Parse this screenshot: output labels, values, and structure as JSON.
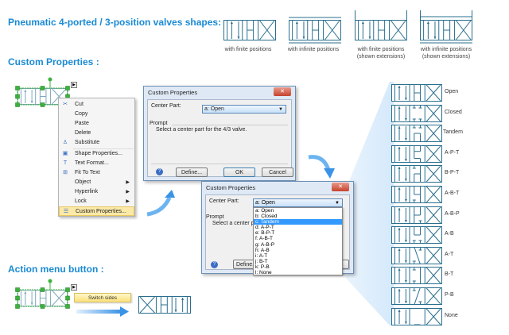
{
  "headings": {
    "pneumatic": "Pneumatic 4-ported / 3-position valves shapes:",
    "custom_properties": "Custom Properties :",
    "action_menu": "Action menu button :"
  },
  "shapes": [
    {
      "caption": "with finite positions",
      "caption2": ""
    },
    {
      "caption": "with infinite positions",
      "caption2": ""
    },
    {
      "caption": "with finite positions",
      "caption2": "(shown extensions)"
    },
    {
      "caption": "with infinite positions",
      "caption2": "(shown extensions)"
    }
  ],
  "context_menu": {
    "items": [
      {
        "label": "Cut",
        "icon": "scissors-icon"
      },
      {
        "label": "Copy",
        "icon": ""
      },
      {
        "label": "Paste",
        "icon": ""
      },
      {
        "label": "Delete",
        "icon": ""
      },
      {
        "label": "Substitute",
        "icon": "substitute-icon"
      },
      {
        "label": "Shape Properties...",
        "icon": "shape-properties-icon"
      },
      {
        "label": "Text Format...",
        "icon": "text-format-icon"
      },
      {
        "label": "Fit To Text",
        "icon": "fit-to-text-icon"
      },
      {
        "label": "Object",
        "icon": "",
        "submenu": true
      },
      {
        "label": "Hyperlink",
        "icon": "",
        "submenu": true
      },
      {
        "label": "Lock",
        "icon": "",
        "submenu": true
      },
      {
        "label": "Custom Properties...",
        "icon": "custom-properties-icon",
        "selected": true
      }
    ]
  },
  "dialog1": {
    "title": "Custom Properties",
    "field_label": "Center Part:",
    "field_value": "a: Open",
    "prompt_label": "Prompt",
    "prompt_text": "Select a center part for the 4/3 valve.",
    "define": "Define...",
    "ok": "OK",
    "cancel": "Cancel"
  },
  "dialog2": {
    "title": "Custom Properties",
    "field_label": "Center Part:",
    "field_value": "a: Open",
    "prompt_label": "Prompt",
    "prompt_text": "Select a center part f",
    "define": "Define...",
    "options": [
      "a:  Open",
      "b:  Closed",
      "c:  Tandem",
      "d:  A-P-T",
      "e:  B-P-T",
      "f:  A-B-T",
      "g:  A-B-P",
      "h:  A-B",
      "i:  A-T",
      "j:  B-T",
      "k:  P-B",
      "l:  None"
    ],
    "highlighted": "c:  Tandem"
  },
  "variants": [
    "Open",
    "Closed",
    "Tandem",
    "A-P-T",
    "B-P-T",
    "A-B-T",
    "A-B-P",
    "A-B",
    "A-T",
    "B-T",
    "P-B",
    "None"
  ],
  "action": {
    "tooltip": "Switch sides"
  },
  "colors": {
    "accent": "#1a8ad4",
    "valve": "#2a6f8e",
    "highlight": "#3399ff"
  }
}
